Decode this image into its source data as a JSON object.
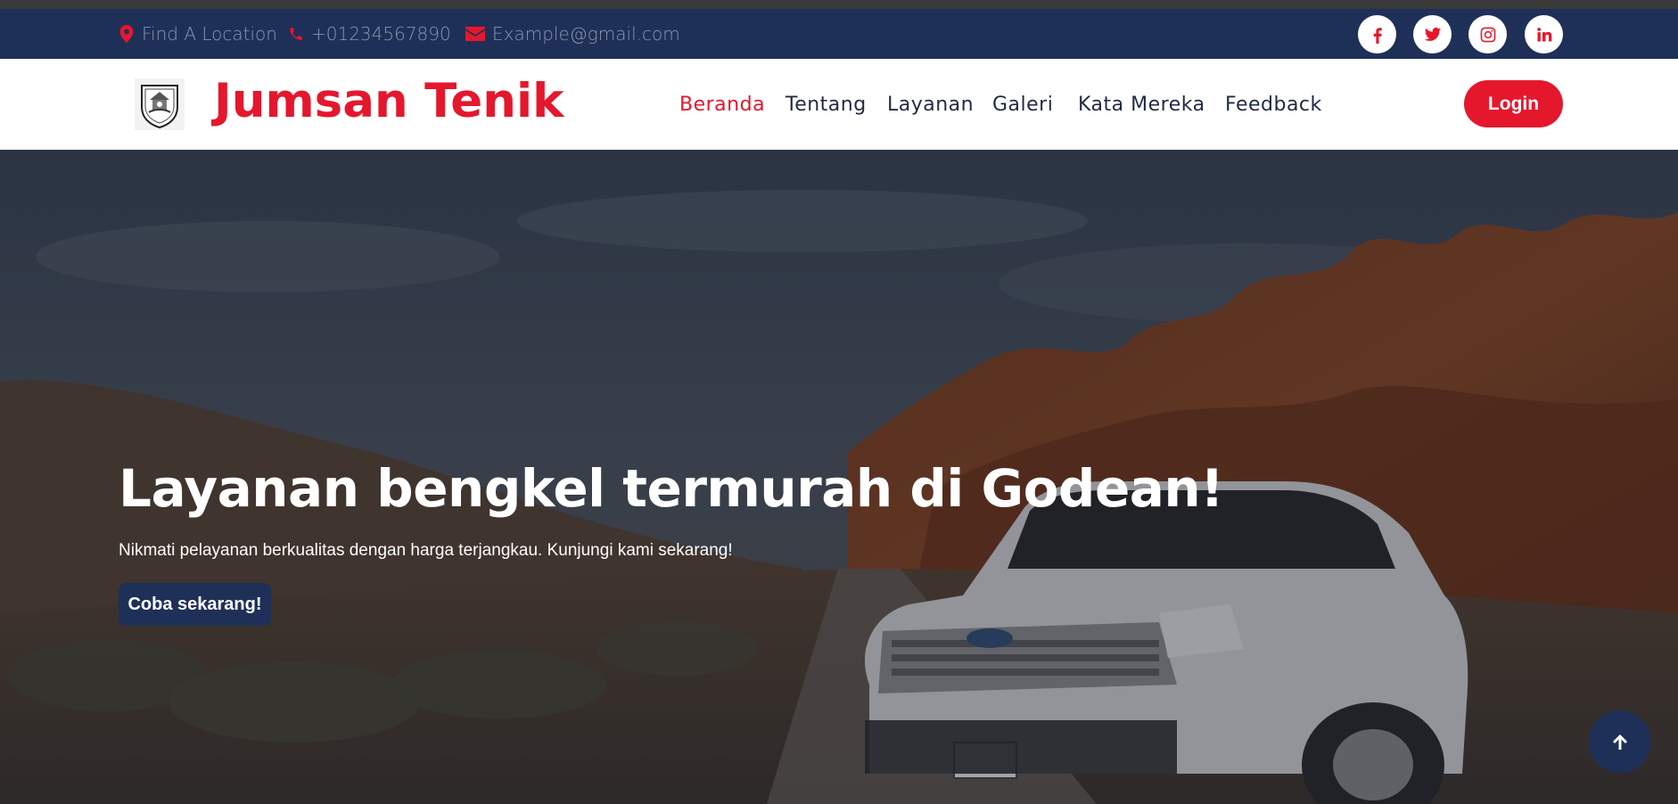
{
  "topbar": {
    "location": {
      "icon": "map-marker-icon",
      "text": "Find A Location"
    },
    "phone": {
      "icon": "phone-icon",
      "text": "+01234567890"
    },
    "email": {
      "icon": "envelope-icon",
      "text": "Example@gmail.com"
    },
    "social": [
      {
        "icon": "facebook-icon",
        "glyph": "f"
      },
      {
        "icon": "twitter-icon"
      },
      {
        "icon": "instagram-icon"
      },
      {
        "icon": "linkedin-icon",
        "glyph": "in"
      }
    ]
  },
  "navbar": {
    "brand": "Jumsan Tenik",
    "logo": "emblem-logo",
    "items": [
      {
        "label": "Beranda",
        "active": true
      },
      {
        "label": "Tentang",
        "active": false
      },
      {
        "label": "Layanan",
        "active": false
      },
      {
        "label": "Galeri",
        "active": false
      },
      {
        "label": "Kata Mereka",
        "active": false
      },
      {
        "label": "Feedback",
        "active": false
      }
    ],
    "login_label": "Login"
  },
  "hero": {
    "title": "Layanan bengkel termurah di Godean!",
    "subtitle": "Nikmati pelayanan berkualitas dengan harga terjangkau. Kunjungi kami sekarang!",
    "cta_label": "Coba sekarang!",
    "background": "desert-canyon-white-suv-photo"
  },
  "back_to_top": {
    "icon": "arrow-up-icon"
  },
  "colors": {
    "primary_red": "#e5172d",
    "navy": "#1f3058",
    "white": "#ffffff"
  }
}
